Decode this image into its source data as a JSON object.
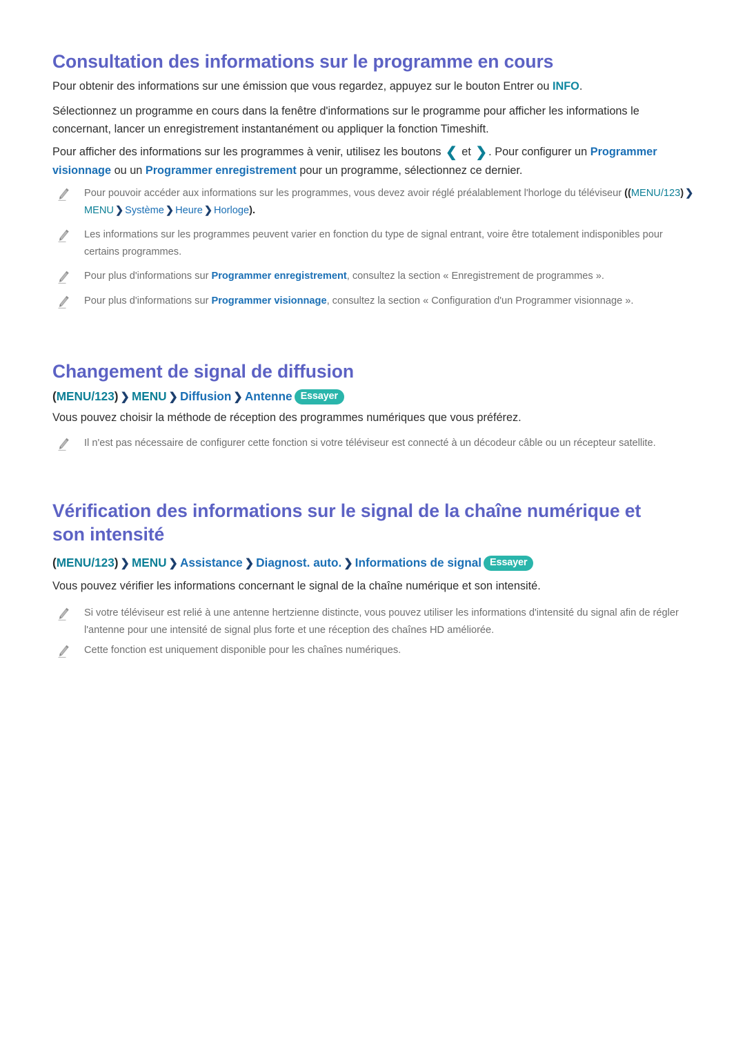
{
  "document": {
    "language": "fr",
    "page_background": "#ffffff",
    "colors": {
      "heading": "#5c62c4",
      "body_text": "#2d2d2d",
      "note_text": "#6e6e6e",
      "teal": "#0c7f96",
      "blue": "#1a6fb5",
      "arrow": "#1c3f6e",
      "badge_background": "#2ab5ab",
      "badge_text": "#ffffff",
      "info_keyword": "#0f87a0"
    }
  },
  "sections": [
    {
      "id": "consultation",
      "title": "Consultation des informations sur le programme en cours",
      "paragraphs": {
        "p1_before": "Pour obtenir des informations sur une émission que vous regardez, appuyez sur le bouton Entrer ou ",
        "p1_keyword": "INFO",
        "p1_after": ".",
        "p2": "Sélectionnez un programme en cours dans la fenêtre d'informations sur le programme pour afficher les informations le concernant, lancer un enregistrement instantanément ou appliquer la fonction Timeshift.",
        "p3_a": "Pour afficher des informations sur les programmes à venir, utilisez les boutons ",
        "p3_chevron_left": "❮",
        "p3_mid": " et ",
        "p3_chevron_right": "❯",
        "p3_b": ". Pour configurer un ",
        "p3_kw1": "Programmer visionnage",
        "p3_c": " ou un ",
        "p3_kw2": "Programmer enregistrement",
        "p3_d": " pour un programme, sélectionnez ce dernier."
      },
      "notes": [
        {
          "icon": "pencil-icon",
          "text_a": "Pour pouvoir accéder aux informations sur les programmes, vous devez avoir réglé préalablement l'horloge du téléviseur ",
          "path_open": "((",
          "path": [
            {
              "label": "MENU/123",
              "color": "teal"
            },
            {
              "label": "MENU",
              "color": "teal"
            },
            {
              "label": "Système",
              "color": "blue"
            },
            {
              "label": "Heure",
              "color": "blue"
            },
            {
              "label": "Horloge",
              "color": "blue"
            }
          ],
          "path_close": ").",
          "separator": "❯"
        },
        {
          "icon": "pencil-icon",
          "text": "Les informations sur les programmes peuvent varier en fonction du type de signal entrant, voire être totalement indisponibles pour certains programmes."
        },
        {
          "icon": "pencil-icon",
          "text_a": "Pour plus d'informations sur ",
          "keyword": "Programmer enregistrement",
          "text_b": ", consultez la section « Enregistrement de programmes »."
        },
        {
          "icon": "pencil-icon",
          "text_a": "Pour plus d'informations sur ",
          "keyword": "Programmer visionnage",
          "text_b": ", consultez la section « Configuration d'un Programmer visionnage »."
        }
      ]
    },
    {
      "id": "changement-signal",
      "title": "Changement de signal de diffusion",
      "breadcrumb": {
        "open": "(",
        "items": [
          {
            "label": "MENU/123",
            "color": "teal"
          },
          {
            "label": "MENU",
            "color": "teal"
          },
          {
            "label": "Diffusion",
            "color": "blue"
          },
          {
            "label": "Antenne",
            "color": "blue"
          }
        ],
        "close": ")",
        "separator": "❯",
        "badge": "Essayer"
      },
      "paragraph": "Vous pouvez choisir la méthode de réception des programmes numériques que vous préférez.",
      "notes": [
        {
          "icon": "pencil-icon",
          "text": "Il n'est pas nécessaire de configurer cette fonction si votre téléviseur est connecté à un décodeur câble ou un récepteur satellite."
        }
      ]
    },
    {
      "id": "verification-signal",
      "title": "Vérification des informations sur le signal de la chaîne numérique et son intensité",
      "breadcrumb": {
        "open": "(",
        "items": [
          {
            "label": "MENU/123",
            "color": "teal"
          },
          {
            "label": "MENU",
            "color": "teal"
          },
          {
            "label": "Assistance",
            "color": "blue"
          },
          {
            "label": "Diagnost. auto.",
            "color": "blue"
          },
          {
            "label": "Informations de signal",
            "color": "blue"
          }
        ],
        "close": ")",
        "separator": "❯",
        "badge": "Essayer"
      },
      "paragraph": "Vous pouvez vérifier les informations concernant le signal de la chaîne numérique et son intensité.",
      "notes": [
        {
          "icon": "pencil-icon",
          "text": "Si votre téléviseur est relié à une antenne hertzienne distincte, vous pouvez utiliser les informations d'intensité du signal afin de régler l'antenne pour une intensité de signal plus forte et une réception des chaînes HD améliorée."
        },
        {
          "icon": "pencil-icon",
          "text": "Cette fonction est uniquement disponible pour les chaînes numériques."
        }
      ]
    }
  ]
}
